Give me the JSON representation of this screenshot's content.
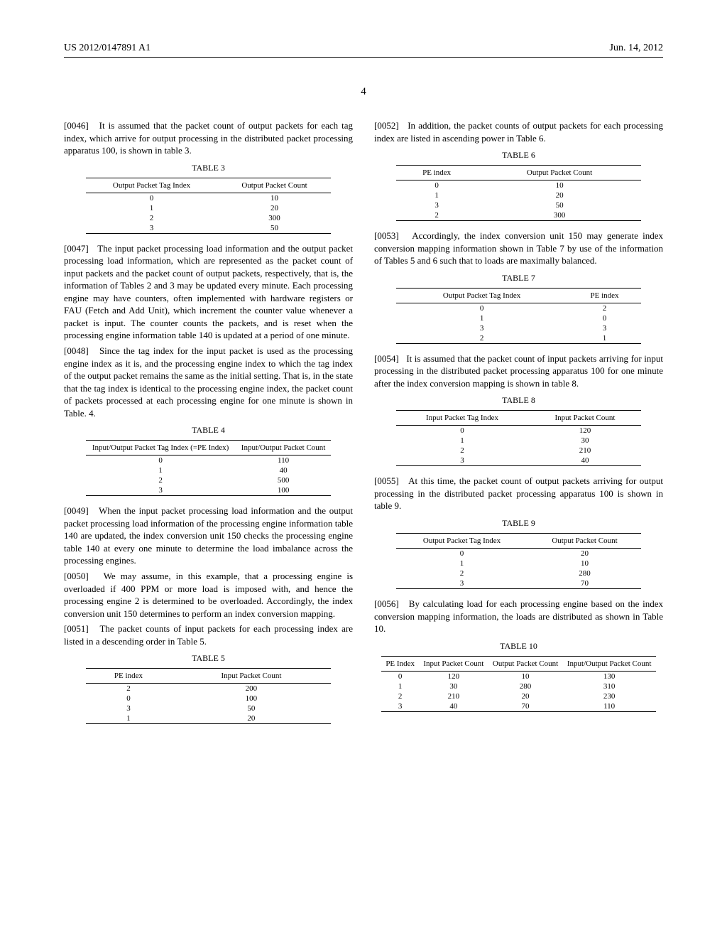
{
  "header": {
    "pub_number": "US 2012/0147891 A1",
    "pub_date": "Jun. 14, 2012"
  },
  "page_number": "4",
  "left_column": {
    "para0046": {
      "num": "[0046]",
      "text": "It is assumed that the packet count of output packets for each tag index, which arrive for output processing in the distributed packet processing apparatus 100, is shown in table 3."
    },
    "table3": {
      "caption": "TABLE 3",
      "headers": [
        "Output Packet Tag Index",
        "Output Packet Count"
      ],
      "rows": [
        [
          "0",
          "10"
        ],
        [
          "1",
          "20"
        ],
        [
          "2",
          "300"
        ],
        [
          "3",
          "50"
        ]
      ]
    },
    "para0047": {
      "num": "[0047]",
      "text": "The input packet processing load information and the output packet processing load information, which are represented as the packet count of input packets and the packet count of output packets, respectively, that is, the information of Tables 2 and 3 may be updated every minute. Each processing engine may have counters, often implemented with hardware registers or FAU (Fetch and Add Unit), which increment the counter value whenever a packet is input. The counter counts the packets, and is reset when the processing engine information table 140 is updated at a period of one minute."
    },
    "para0048": {
      "num": "[0048]",
      "text": "Since the tag index for the input packet is used as the processing engine index as it is, and the processing engine index to which the tag index of the output packet remains the same as the initial setting. That is, in the state that the tag index is identical to the processing engine index, the packet count of packets processed at each processing engine for one minute is shown in Table. 4."
    },
    "table4": {
      "caption": "TABLE 4",
      "headers": [
        "Input/Output Packet Tag Index (=PE Index)",
        "Input/Output Packet Count"
      ],
      "rows": [
        [
          "0",
          "110"
        ],
        [
          "1",
          "40"
        ],
        [
          "2",
          "500"
        ],
        [
          "3",
          "100"
        ]
      ]
    },
    "para0049": {
      "num": "[0049]",
      "text": "When the input packet processing load information and the output packet processing load information of the processing engine information table 140 are updated, the index conversion unit 150 checks the processing engine table 140 at every one minute to determine the load imbalance across the processing engines."
    },
    "para0050": {
      "num": "[0050]",
      "text": "We may assume, in this example, that a processing engine is overloaded if 400 PPM or more load is imposed with, and hence the processing engine 2 is determined to be overloaded. Accordingly, the index conversion unit 150 determines to perform an index conversion mapping."
    },
    "para0051": {
      "num": "[0051]",
      "text": "The packet counts of input packets for each processing index are listed in a descending order in Table 5."
    },
    "table5": {
      "caption": "TABLE 5",
      "headers": [
        "PE index",
        "Input Packet Count"
      ],
      "rows": [
        [
          "2",
          "200"
        ],
        [
          "0",
          "100"
        ],
        [
          "3",
          "50"
        ],
        [
          "1",
          "20"
        ]
      ]
    }
  },
  "right_column": {
    "para0052": {
      "num": "[0052]",
      "text": "In addition, the packet counts of output packets for each processing index are listed in ascending power in Table 6."
    },
    "table6": {
      "caption": "TABLE 6",
      "headers": [
        "PE index",
        "Output Packet Count"
      ],
      "rows": [
        [
          "0",
          "10"
        ],
        [
          "1",
          "20"
        ],
        [
          "3",
          "50"
        ],
        [
          "2",
          "300"
        ]
      ]
    },
    "para0053": {
      "num": "[0053]",
      "text": "Accordingly, the index conversion unit 150 may generate index conversion mapping information shown in Table 7 by use of the information of Tables 5 and 6 such that to loads are maximally balanced."
    },
    "table7": {
      "caption": "TABLE 7",
      "headers": [
        "Output Packet Tag Index",
        "PE index"
      ],
      "rows": [
        [
          "0",
          "2"
        ],
        [
          "1",
          "0"
        ],
        [
          "3",
          "3"
        ],
        [
          "2",
          "1"
        ]
      ]
    },
    "para0054": {
      "num": "[0054]",
      "text": "It is assumed that the packet count of input packets arriving for input processing in the distributed packet processing apparatus 100 for one minute after the index conversion mapping is shown in table 8."
    },
    "table8": {
      "caption": "TABLE 8",
      "headers": [
        "Input Packet Tag Index",
        "Input Packet Count"
      ],
      "rows": [
        [
          "0",
          "120"
        ],
        [
          "1",
          "30"
        ],
        [
          "2",
          "210"
        ],
        [
          "3",
          "40"
        ]
      ]
    },
    "para0055": {
      "num": "[0055]",
      "text": "At this time, the packet count of output packets arriving for output processing in the distributed packet processing apparatus 100 is shown in table 9."
    },
    "table9": {
      "caption": "TABLE 9",
      "headers": [
        "Output Packet Tag Index",
        "Output Packet Count"
      ],
      "rows": [
        [
          "0",
          "20"
        ],
        [
          "1",
          "10"
        ],
        [
          "2",
          "280"
        ],
        [
          "3",
          "70"
        ]
      ]
    },
    "para0056": {
      "num": "[0056]",
      "text": "By calculating load for each processing engine based on the index conversion mapping information, the loads are distributed as shown in Table 10."
    },
    "table10": {
      "caption": "TABLE 10",
      "headers": [
        "PE Index",
        "Input Packet Count",
        "Output Packet Count",
        "Input/Output Packet Count"
      ],
      "rows": [
        [
          "0",
          "120",
          "10",
          "130"
        ],
        [
          "1",
          "30",
          "280",
          "310"
        ],
        [
          "2",
          "210",
          "20",
          "230"
        ],
        [
          "3",
          "40",
          "70",
          "110"
        ]
      ]
    }
  },
  "chart_data": [
    {
      "type": "table",
      "title": "TABLE 3",
      "headers": [
        "Output Packet Tag Index",
        "Output Packet Count"
      ],
      "rows": [
        [
          "0",
          "10"
        ],
        [
          "1",
          "20"
        ],
        [
          "2",
          "300"
        ],
        [
          "3",
          "50"
        ]
      ]
    },
    {
      "type": "table",
      "title": "TABLE 4",
      "headers": [
        "Input/Output Packet Tag Index (=PE Index)",
        "Input/Output Packet Count"
      ],
      "rows": [
        [
          "0",
          "110"
        ],
        [
          "1",
          "40"
        ],
        [
          "2",
          "500"
        ],
        [
          "3",
          "100"
        ]
      ]
    },
    {
      "type": "table",
      "title": "TABLE 5",
      "headers": [
        "PE index",
        "Input Packet Count"
      ],
      "rows": [
        [
          "2",
          "200"
        ],
        [
          "0",
          "100"
        ],
        [
          "3",
          "50"
        ],
        [
          "1",
          "20"
        ]
      ]
    },
    {
      "type": "table",
      "title": "TABLE 6",
      "headers": [
        "PE index",
        "Output Packet Count"
      ],
      "rows": [
        [
          "0",
          "10"
        ],
        [
          "1",
          "20"
        ],
        [
          "3",
          "50"
        ],
        [
          "2",
          "300"
        ]
      ]
    },
    {
      "type": "table",
      "title": "TABLE 7",
      "headers": [
        "Output Packet Tag Index",
        "PE index"
      ],
      "rows": [
        [
          "0",
          "2"
        ],
        [
          "1",
          "0"
        ],
        [
          "3",
          "3"
        ],
        [
          "2",
          "1"
        ]
      ]
    },
    {
      "type": "table",
      "title": "TABLE 8",
      "headers": [
        "Input Packet Tag Index",
        "Input Packet Count"
      ],
      "rows": [
        [
          "0",
          "120"
        ],
        [
          "1",
          "30"
        ],
        [
          "2",
          "210"
        ],
        [
          "3",
          "40"
        ]
      ]
    },
    {
      "type": "table",
      "title": "TABLE 9",
      "headers": [
        "Output Packet Tag Index",
        "Output Packet Count"
      ],
      "rows": [
        [
          "0",
          "20"
        ],
        [
          "1",
          "10"
        ],
        [
          "2",
          "280"
        ],
        [
          "3",
          "70"
        ]
      ]
    },
    {
      "type": "table",
      "title": "TABLE 10",
      "headers": [
        "PE Index",
        "Input Packet Count",
        "Output Packet Count",
        "Input/Output Packet Count"
      ],
      "rows": [
        [
          "0",
          "120",
          "10",
          "130"
        ],
        [
          "1",
          "30",
          "280",
          "310"
        ],
        [
          "2",
          "210",
          "20",
          "230"
        ],
        [
          "3",
          "40",
          "70",
          "110"
        ]
      ]
    }
  ]
}
